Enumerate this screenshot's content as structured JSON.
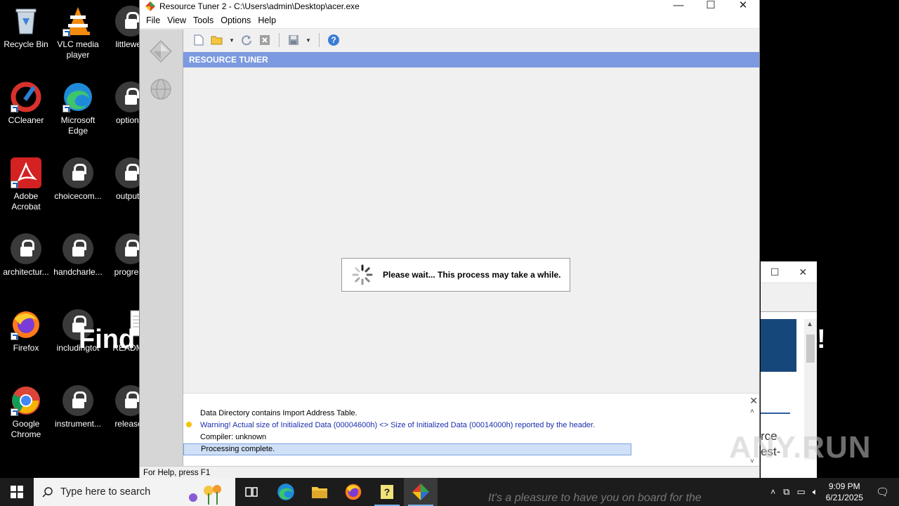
{
  "desktop": {
    "icons": [
      {
        "label": "Recycle Bin"
      },
      {
        "label": "VLC media player"
      },
      {
        "label": "littleweb"
      },
      {
        "label": "CCleaner"
      },
      {
        "label": "Microsoft Edge"
      },
      {
        "label": "optional"
      },
      {
        "label": "Adobe Acrobat"
      },
      {
        "label": "choicecom..."
      },
      {
        "label": "outputvi"
      },
      {
        "label": "architectur..."
      },
      {
        "label": "handcharle..."
      },
      {
        "label": "progress"
      },
      {
        "label": "Firefox"
      },
      {
        "label": "includingtot"
      },
      {
        "label": "README"
      },
      {
        "label": "Google Chrome"
      },
      {
        "label": "instrument..."
      },
      {
        "label": "releases"
      }
    ],
    "overlay_find": "Find",
    "bg_window_text": "rce\nest-",
    "bg_window_exclaim": "!"
  },
  "window": {
    "title": "Resource Tuner 2 - C:\\Users\\admin\\Desktop\\acer.exe",
    "menu": [
      "File",
      "View",
      "Tools",
      "Options",
      "Help"
    ],
    "header": "RESOURCE TUNER",
    "wait_message": "Please wait... This process may take a while.",
    "log": [
      "Data Directory contains Import Address Table.",
      "Warning! Actual size of Initialized Data (00004600h) <> Size of Initialized Data (00014000h) reported by the header.",
      "Compiler: unknown",
      "Processing complete."
    ],
    "status": "For Help, press F1"
  },
  "taskbar": {
    "search_placeholder": "Type here to search",
    "time": "9:09 PM",
    "date": "6/21/2025"
  },
  "watermark": "ANY.RUN",
  "bottom_overlay": "It's a pleasure to have you on board for the"
}
